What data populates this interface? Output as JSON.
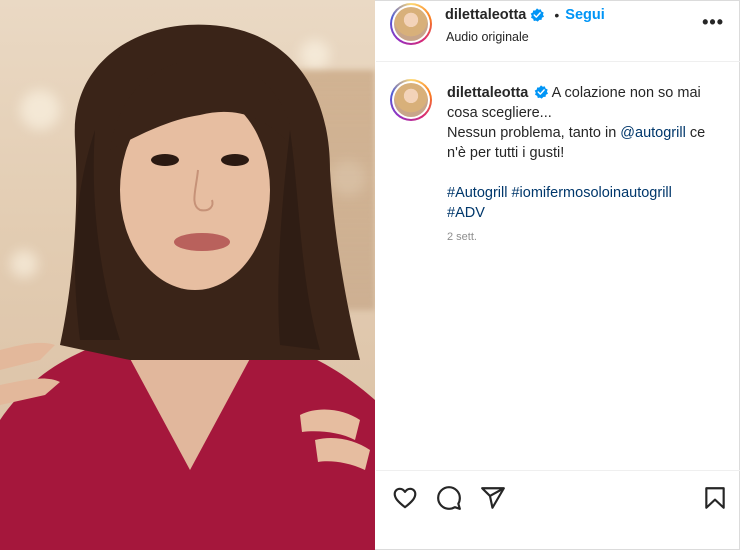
{
  "post": {
    "username": "dilettaleotta",
    "separator": "•",
    "follow_label": "Segui",
    "audio": "Audio originale",
    "more_label": "•••"
  },
  "caption": {
    "username": "dilettaleotta",
    "line1": "A colazione non so mai cosa scegliere...",
    "line2_prefix": "Nessun problema, tanto in ",
    "mention": "@autogrill",
    "line2_suffix": " ce n'è per tutti i gusti!",
    "hashtag1": "#Autogrill",
    "hashtag2": "#iomifermosoloinautogrill",
    "hashtag3": "#ADV",
    "time": "2 sett."
  },
  "icons": {
    "verified": "verified-badge-icon",
    "like": "heart-icon",
    "comment": "comment-icon",
    "share": "paper-plane-icon",
    "save": "bookmark-icon"
  },
  "colors": {
    "follow": "#0095f6",
    "link": "#00376b",
    "verified": "#0095f6",
    "muted": "#8e8e8e"
  }
}
